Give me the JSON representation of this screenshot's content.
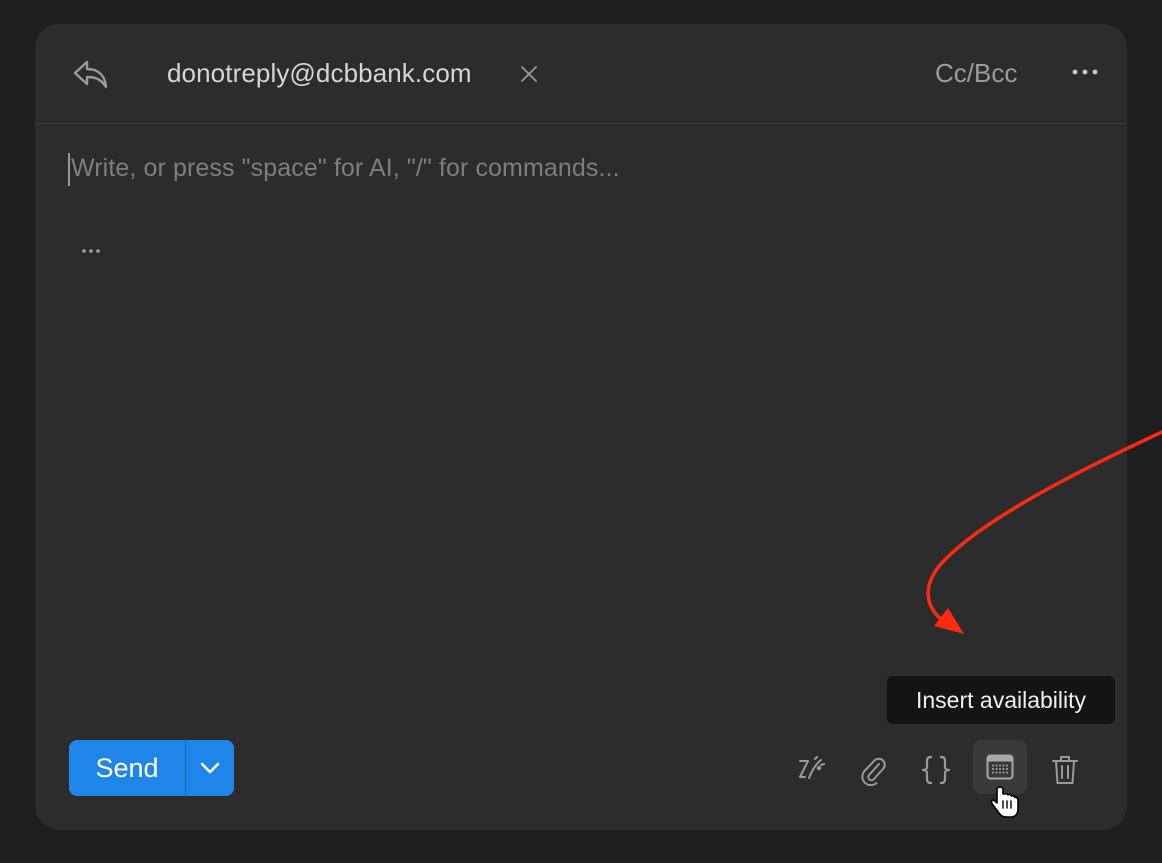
{
  "header": {
    "recipient": "donotreply@dcbbank.com",
    "cc_bcc_label": "Cc/Bcc"
  },
  "body": {
    "placeholder": "Write, or press \"space\" for AI, \"/\" for commands...",
    "quote_toggle": "..."
  },
  "footer": {
    "send_label": "Send",
    "tools": [
      {
        "icon": "ai-write-icon"
      },
      {
        "icon": "paperclip-icon"
      },
      {
        "icon": "braces-icon"
      },
      {
        "icon": "calendar-icon",
        "active": true
      },
      {
        "icon": "trash-icon"
      }
    ],
    "tooltip": "Insert availability"
  },
  "colors": {
    "background": "#1e1e1f",
    "panel": "#2c2c2d",
    "accent": "#1f85e8",
    "annotation": "#ff2a12"
  }
}
